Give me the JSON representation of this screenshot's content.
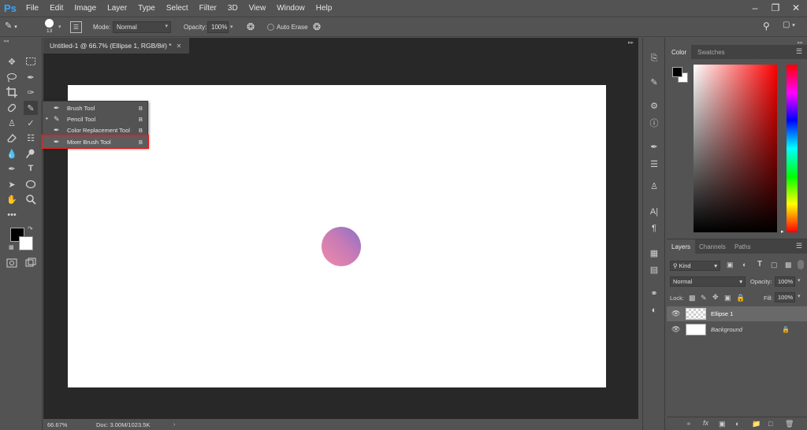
{
  "app": {
    "logo": "Ps"
  },
  "menu": [
    "File",
    "Edit",
    "Image",
    "Layer",
    "Type",
    "Select",
    "Filter",
    "3D",
    "View",
    "Window",
    "Help"
  ],
  "options": {
    "brush_size": "13",
    "mode_label": "Mode:",
    "mode_value": "Normal",
    "opacity_label": "Opacity:",
    "opacity_value": "100%",
    "auto_erase_label": "Auto Erase"
  },
  "document": {
    "tab_title": "Untitled-1 @ 66.7% (Ellipse 1, RGB/8#) *",
    "zoom": "66.67%",
    "doc_size": "Doc: 3.00M/1023.5K"
  },
  "flyout": {
    "items": [
      {
        "label": "Brush Tool",
        "key": "B"
      },
      {
        "label": "Pencil Tool",
        "key": "B"
      },
      {
        "label": "Color Replacement Tool",
        "key": "B"
      },
      {
        "label": "Mixer Brush Tool",
        "key": "B"
      }
    ]
  },
  "color_panel": {
    "tabs": [
      "Color",
      "Swatches"
    ]
  },
  "layers_panel": {
    "tabs": [
      "Layers",
      "Channels",
      "Paths"
    ],
    "filter_kind": "Kind",
    "blend_mode": "Normal",
    "opacity_label": "Opacity:",
    "opacity_value": "100%",
    "lock_label": "Lock:",
    "fill_label": "Fill:",
    "fill_value": "100%",
    "layers": [
      {
        "name": "Ellipse 1",
        "selected": true
      },
      {
        "name": "Background",
        "selected": false
      }
    ]
  },
  "colors": {
    "accent": "#31a8ff",
    "highlight_border": "#e02020"
  }
}
